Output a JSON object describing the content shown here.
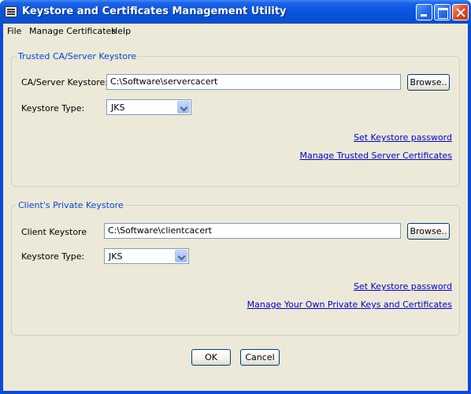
{
  "window": {
    "title": "Keystore and Certificates Management Utility"
  },
  "menubar": {
    "items": [
      "File",
      "Manage Certificates",
      "Help"
    ]
  },
  "trusted": {
    "legend": "Trusted CA/Server Keystore",
    "keystore_label": "CA/Server Keystore:",
    "keystore_value": "C:\\Software\\servercacert",
    "browse_label": "Browse..",
    "type_label": "Keystore Type:",
    "type_value": "JKS",
    "set_password_link": "Set Keystore password",
    "manage_link": "Manage Trusted Server Certificates"
  },
  "client": {
    "legend": "Client's Private Keystore",
    "keystore_label": "Client Keystore",
    "keystore_value": "C:\\Software\\clientcacert",
    "browse_label": "Browse..",
    "type_label": "Keystore Type:",
    "type_value": "JKS",
    "set_password_link": "Set Keystore password",
    "manage_link": "Manage Your Own Private Keys and Certificates"
  },
  "footer": {
    "ok_label": "OK",
    "cancel_label": "Cancel"
  }
}
